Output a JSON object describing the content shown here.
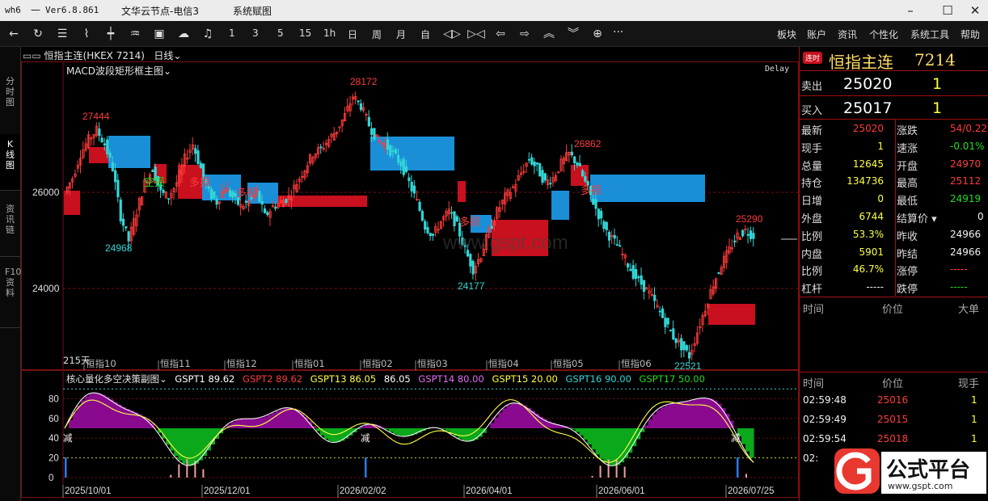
{
  "titlebar": {
    "app": "wh6",
    "dash": "—",
    "version": "Ver6.8.861",
    "server": "文华云节点-电信3",
    "mode": "系统赋图"
  },
  "toolbar": {
    "periods": [
      "1",
      "3",
      "5",
      "15",
      "1h",
      "日",
      "周",
      "月",
      "自"
    ],
    "menus": [
      "板块",
      "账户",
      "资讯",
      "个性化",
      "系统工具",
      "帮助"
    ],
    "more": "···"
  },
  "sidetabs": [
    "分时图",
    "K线图",
    "资讯链",
    "F10资料"
  ],
  "chart": {
    "contract": "恒指主连(HKEX 7214)",
    "period": "日线",
    "indicator": "MACD波段矩形框主图",
    "delay": "Delay",
    "yticks": [
      "26000",
      "24000"
    ],
    "price_labels": [
      "27444",
      "28172",
      "26862",
      "25290",
      "24968",
      "24177",
      "22521"
    ],
    "box_labels": [
      "空损",
      "多损",
      "多损",
      "多损",
      "多损"
    ],
    "month_labels": [
      "恒指10",
      "恒指11",
      "恒指12",
      "恒指01",
      "恒指02",
      "恒指03",
      "恒指04",
      "恒指05",
      "恒指06"
    ],
    "days": "215天",
    "watermark": "www.gspt.com"
  },
  "sub": {
    "title": "核心量化多空决策副图",
    "gspt1": "GSPT1 89.62",
    "gspt2": "GSPT2 89.62",
    "gspt13": "GSPT13 86.05",
    "extra": "86.05",
    "gspt14": "GSPT14 80.00",
    "gspt15": "GSPT15 20.00",
    "gspt16": "GSPT16 90.00",
    "gspt17": "GSPT17 50.00",
    "yticks": [
      "80",
      "60",
      "40",
      "20",
      "0"
    ],
    "markers": [
      "减",
      "减",
      "减"
    ],
    "dates": [
      "2025/10/01",
      "2025/12/01",
      "2026/02/02",
      "2026/04/01",
      "2026/06/01",
      "2026/07/25"
    ]
  },
  "quote": {
    "badge": "连时",
    "name": "恒指主连",
    "code": "7214",
    "sell_label": "卖出",
    "sell_price": "25020",
    "sell_vol": "1",
    "buy_label": "买入",
    "buy_price": "25017",
    "buy_vol": "1",
    "rows": [
      {
        "l1": "最新",
        "v1": "25020",
        "c1": "red",
        "l2": "涨跌",
        "v2": "54/0.22%",
        "c2": "red"
      },
      {
        "l1": "现手",
        "v1": "1",
        "c1": "yel",
        "l2": "速涨",
        "v2": "-0.01%",
        "c2": "green"
      },
      {
        "l1": "总量",
        "v1": "12645",
        "c1": "yel",
        "l2": "开盘",
        "v2": "24970",
        "c2": "red"
      },
      {
        "l1": "持仓",
        "v1": "134736",
        "c1": "yel",
        "l2": "最高",
        "v2": "25112",
        "c2": "red"
      },
      {
        "l1": "日增",
        "v1": "0",
        "c1": "yel",
        "l2": "最低",
        "v2": "24919",
        "c2": "green"
      },
      {
        "l1": "外盘",
        "v1": "6744",
        "c1": "yel",
        "l2": "结算价",
        "v2": "0",
        "c2": "wht"
      },
      {
        "l1": "比例",
        "v1": "53.3%",
        "c1": "yel",
        "l2": "昨收",
        "v2": "24966",
        "c2": "wht"
      },
      {
        "l1": "内盘",
        "v1": "5901",
        "c1": "yel",
        "l2": "昨结",
        "v2": "24966",
        "c2": "wht"
      },
      {
        "l1": "比例",
        "v1": "46.7%",
        "c1": "yel",
        "l2": "涨停",
        "v2": "-----",
        "c2": "red"
      },
      {
        "l1": "杠杆",
        "v1": "-----",
        "c1": "wht",
        "l2": "跌停",
        "v2": "-----",
        "c2": "green"
      }
    ],
    "tick_head1": [
      "时间",
      "价位",
      "大单"
    ],
    "tick_head2": [
      "时间",
      "价位",
      "现手"
    ],
    "ticks": [
      {
        "t": "02:59:48",
        "p": "25016",
        "v": "1"
      },
      {
        "t": "02:59:49",
        "p": "25015",
        "v": "1"
      },
      {
        "t": "02:59:54",
        "p": "25018",
        "v": "1"
      },
      {
        "t": "02:",
        "p": "",
        "v": ""
      }
    ]
  },
  "brand": {
    "name": "公式平台",
    "url": "www.gspt.com"
  },
  "colors": {
    "up": "#ff3b3b",
    "down": "#33d6d6",
    "bull_box": "#c8101e",
    "bear_box": "#1a8fd8",
    "purple": "#8a0a8f",
    "green_fill": "#0aa81a"
  },
  "chart_data": {
    "type": "candlestick",
    "price_levels": [
      26000,
      24000
    ],
    "closes": [
      26000,
      26300,
      26800,
      27100,
      27300,
      27000,
      26500,
      25500,
      25000,
      25600,
      26200,
      26500,
      26000,
      25900,
      26200,
      26700,
      27000,
      26500,
      26000,
      25800,
      26100,
      25900,
      25700,
      25800,
      26000,
      25500,
      25700,
      25800,
      25900,
      26200,
      26500,
      26800,
      26900,
      27100,
      27300,
      27600,
      28000,
      27800,
      27400,
      27100,
      27000,
      26800,
      26600,
      26200,
      25800,
      25300,
      25100,
      25400,
      25600,
      25300,
      24800,
      24400,
      24700,
      25200,
      25600,
      25900,
      26100,
      26400,
      26700,
      26500,
      26200,
      26300,
      26600,
      26800,
      26600,
      26200,
      25800,
      25400,
      25100,
      24900,
      24600,
      24300,
      24100,
      23900,
      23600,
      23300,
      23000,
      22800,
      22600,
      23100,
      23600,
      24100,
      24500,
      24800,
      25100,
      25200,
      25100
    ]
  }
}
